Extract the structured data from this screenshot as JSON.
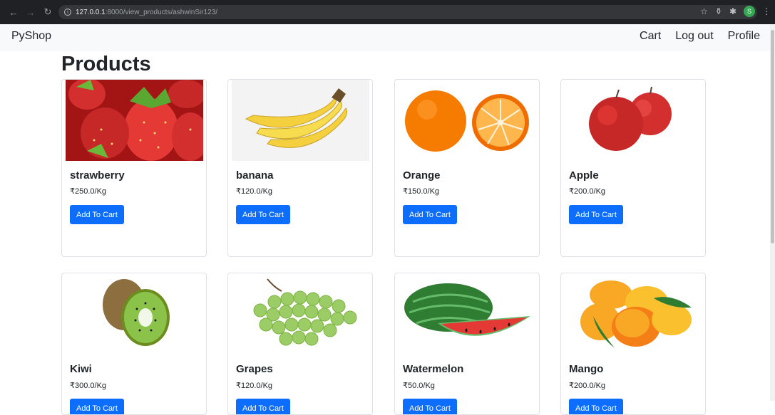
{
  "browser": {
    "url_host": "127.0.0.1",
    "url_rest": ":8000/view_products/ashwinSir123/",
    "profile_initial": "S"
  },
  "navbar": {
    "brand": "PyShop",
    "links": [
      "Cart",
      "Log out",
      "Profile"
    ]
  },
  "page": {
    "title": "Products"
  },
  "products": [
    {
      "name": "strawberry",
      "price": "₹250.0/Kg",
      "button": "Add To Cart"
    },
    {
      "name": "banana",
      "price": "₹120.0/Kg",
      "button": "Add To Cart"
    },
    {
      "name": "Orange",
      "price": "₹150.0/Kg",
      "button": "Add To Cart"
    },
    {
      "name": "Apple",
      "price": "₹200.0/Kg",
      "button": "Add To Cart"
    },
    {
      "name": "Kiwi",
      "price": "₹300.0/Kg",
      "button": "Add To Cart"
    },
    {
      "name": "Grapes",
      "price": "₹120.0/Kg",
      "button": "Add To Cart"
    },
    {
      "name": "Watermelon",
      "price": "₹50.0/Kg",
      "button": "Add To Cart"
    },
    {
      "name": "Mango",
      "price": "₹200.0/Kg",
      "button": "Add To Cart"
    }
  ]
}
